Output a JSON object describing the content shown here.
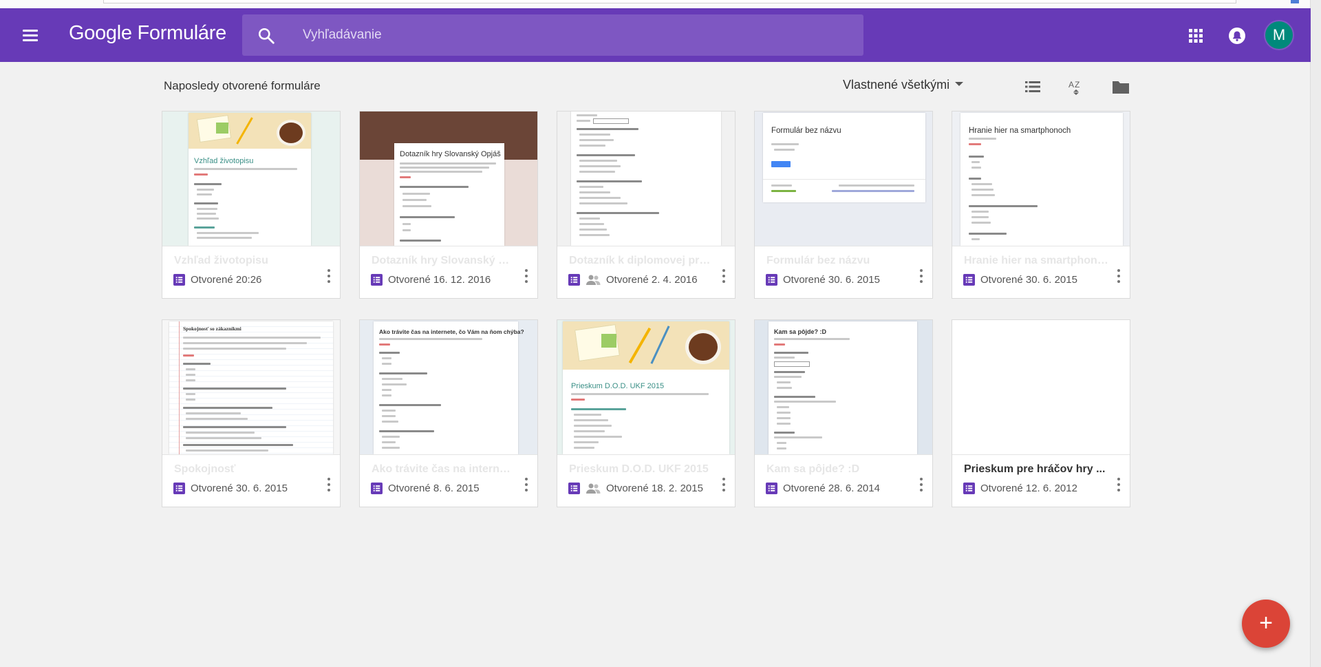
{
  "app": {
    "brand": "Google",
    "product": "Formuláre"
  },
  "search": {
    "placeholder": "Vyhľadávanie"
  },
  "user": {
    "initial": "M"
  },
  "toolbar": {
    "section_title": "Naposledy otvorené formuláre",
    "owner_filter": "Vlastnené všetkými"
  },
  "icons": {
    "menu": "menu-icon",
    "search": "search-icon",
    "apps": "apps-grid-icon",
    "notifications": "bell-icon",
    "list_view": "list-view-icon",
    "sort": "sort-az-icon",
    "folder": "folder-icon",
    "form": "form-icon",
    "shared": "shared-people-icon",
    "more": "more-vert-icon",
    "add": "plus-icon"
  },
  "colors": {
    "appbar": "#673ab7",
    "search": "#7e57c2",
    "form_icon": "#673ab7",
    "avatar": "#00897b",
    "fab": "#db4437"
  },
  "forms": [
    {
      "title": "Vzhľad životopisu",
      "opened": "Otvorené 20:26",
      "shared": false,
      "thumb_title": "Vzhľad životopisu"
    },
    {
      "title": "Dotazník hry Slovanský Opjáš",
      "opened": "Otvorené 16. 12. 2016",
      "shared": false,
      "thumb_title": "Dotazník hry Slovanský Opjáš"
    },
    {
      "title": "Dotazník k diplomovej práci",
      "opened": "Otvorené 2. 4. 2016",
      "shared": true,
      "thumb_title": ""
    },
    {
      "title": "Formulár bez názvu",
      "opened": "Otvorené 30. 6. 2015",
      "shared": false,
      "thumb_title": "Formulár bez názvu"
    },
    {
      "title": "Hranie hier na smartphonoch",
      "opened": "Otvorené 30. 6. 2015",
      "shared": false,
      "thumb_title": "Hranie hier na smartphonoch"
    },
    {
      "title": "Spokojnosť",
      "opened": "Otvorené 30. 6. 2015",
      "shared": false,
      "thumb_title": "Spokojnosť so zákazníkmi"
    },
    {
      "title": "Ako trávite čas na internete, čo Vám na ňom chýba?",
      "opened": "Otvorené 8. 6. 2015",
      "shared": false,
      "thumb_title": "Ako trávite čas na internete, čo Vám na ňom chýba?"
    },
    {
      "title": "Prieskum D.O.D. UKF 2015",
      "opened": "Otvorené 18. 2. 2015",
      "shared": true,
      "thumb_title": "Prieskum D.O.D. UKF 2015"
    },
    {
      "title": "Kam sa pôjde? :D",
      "opened": "Otvorené 28. 6. 2014",
      "shared": false,
      "thumb_title": "Kam sa pôjde? :D"
    },
    {
      "title": "Prieskum pre hráčov hry ...",
      "opened": "Otvorené 12. 6. 2012",
      "shared": false,
      "thumb_title": ""
    }
  ],
  "fab": {
    "label": "+"
  }
}
